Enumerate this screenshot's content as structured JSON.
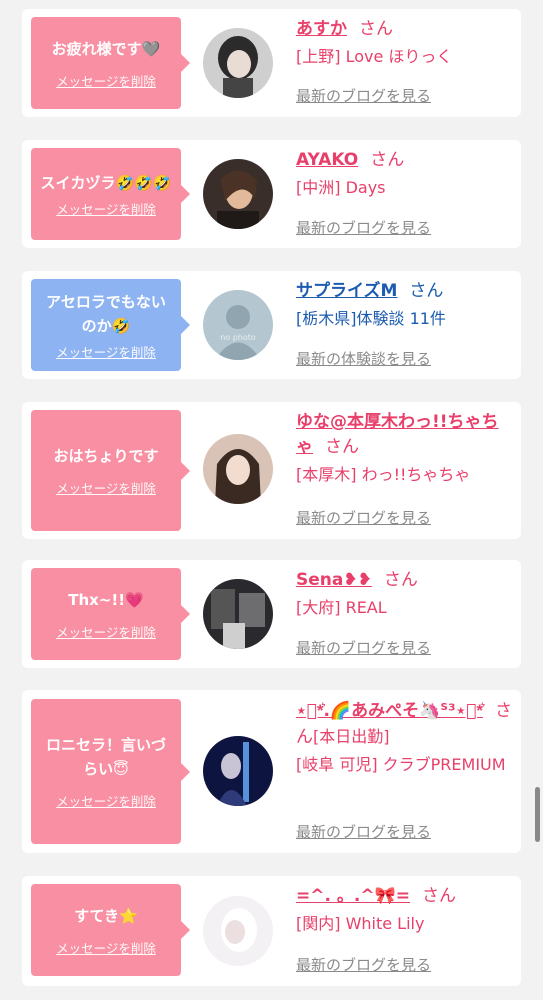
{
  "entries": [
    {
      "message": "お疲れ様です🩶",
      "delete_label": "メッセージを削除",
      "name": "あすか",
      "suffix": "さん",
      "shop": "[上野] Love ほりっく",
      "link": "最新のブログを見る"
    },
    {
      "message": "スイカヅラ🤣🤣🤣",
      "delete_label": "メッセージを削除",
      "name": "AYAKO",
      "suffix": "さん",
      "shop": "[中洲] Days",
      "link": "最新のブログを見る"
    },
    {
      "message": "アセロラでもないのか🤣",
      "delete_label": "メッセージを削除",
      "name": "サプライズM",
      "suffix": "さん",
      "shop": "[栃木県]体験談 11件",
      "link": "最新の体験談を見る",
      "avatar_text": "no photo"
    },
    {
      "message": "おはちょりです",
      "delete_label": "メッセージを削除",
      "name": "ゆな@本厚木わっ!!ちゃちゃ",
      "suffix": "さん",
      "shop": "[本厚木] わっ!!ちゃちゃ",
      "link": "最新のブログを見る"
    },
    {
      "message": "Thx~!!💗",
      "delete_label": "メッセージを削除",
      "name": "Sena❥❥",
      "suffix": "さん",
      "shop": "[大府] REAL",
      "link": "最新のブログを見る"
    },
    {
      "message": "ロニセラ！言いづらい😇",
      "delete_label": "メッセージを削除",
      "name": "⋆͛*͛.🌈あみぺそ🦄ᔆ³⋆͛*͛",
      "suffix": "さん",
      "status": "[本日出勤]",
      "shop": "[岐阜 可児] クラブPREMIUM",
      "link": "最新のブログを見る"
    },
    {
      "message": "すてき⭐",
      "delete_label": "メッセージを削除",
      "name": "=^. 。.^🎀=",
      "suffix": "さん",
      "shop": "[関内] White Lily",
      "link": "最新のブログを見る"
    }
  ],
  "colors": {
    "pink_bubble": "#f98fa2",
    "blue_bubble": "#8eb3f2",
    "name_pink": "#e8406a",
    "name_blue": "#1b5bb0"
  }
}
